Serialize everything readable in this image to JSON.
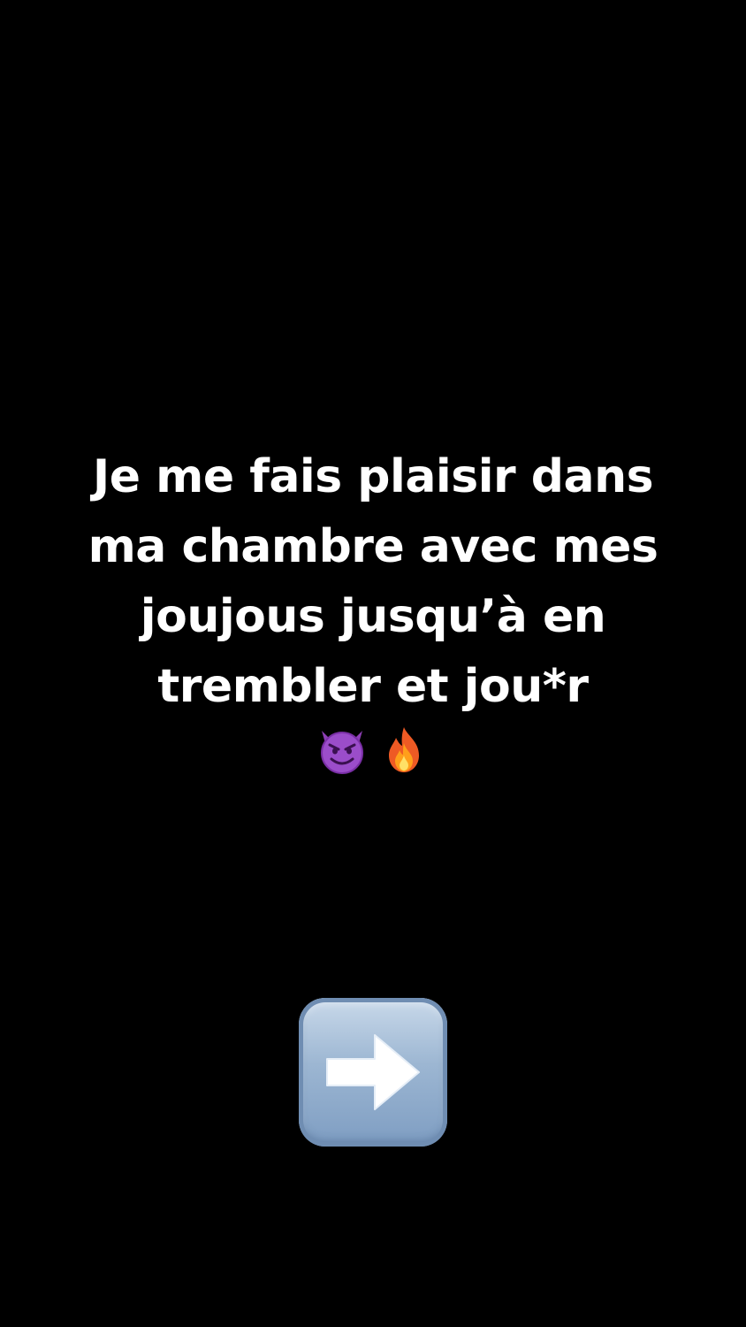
{
  "story": {
    "text_lines": [
      "Je me fais plaisir dans",
      "ma chambre avec mes",
      "joujous jusqu’à en",
      "trembler et jou*r"
    ],
    "emojis": [
      "smiling-devil-icon",
      "fire-icon"
    ]
  },
  "action": {
    "icon": "right-arrow-icon",
    "colors": {
      "button_top": "#c9d9ea",
      "button_bottom": "#7e9dc2",
      "arrow": "#ffffff"
    }
  },
  "colors": {
    "background": "#000000",
    "text": "#ffffff"
  }
}
